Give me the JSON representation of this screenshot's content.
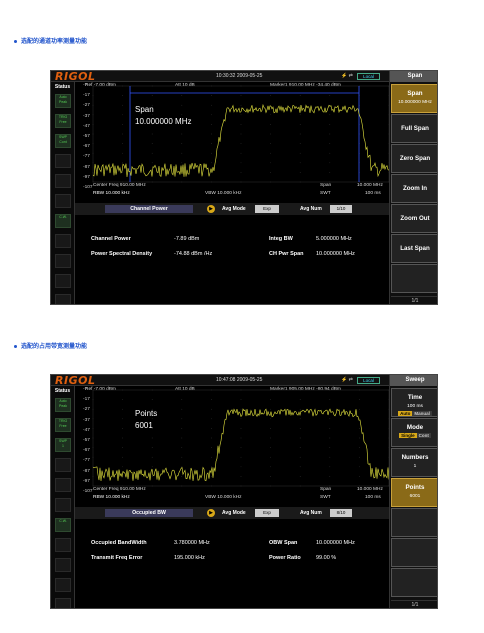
{
  "captions": {
    "cap1": "选配的通道功率测量功能",
    "cap2": "选配的占用带宽测量功能"
  },
  "colors": {
    "trace": "#e8e840",
    "accent": "#d8a818",
    "brand": "#e06010",
    "caption": "#2255cc",
    "lines": "#3355ff"
  },
  "screens": [
    {
      "logo": "RIGOL",
      "datetime": "10:30:32  2009-05-25",
      "local_label": "Local",
      "status_title": "Status",
      "status_icons": [
        {
          "l1": "Auto",
          "l2": "Peak"
        },
        {
          "l1": "TRIG",
          "l2": "Free"
        },
        {
          "l1": "SWP",
          "l2": "Cont"
        },
        {
          "l1": "",
          "l2": ""
        },
        {
          "l1": "",
          "l2": ""
        },
        {
          "l1": "",
          "l2": ""
        },
        {
          "l1": "",
          "l2": "C.W."
        },
        {
          "l1": "",
          "l2": ""
        },
        {
          "l1": "",
          "l2": ""
        },
        {
          "l1": "",
          "l2": ""
        },
        {
          "l1": "",
          "l2": ""
        }
      ],
      "ref": "Ref -7.00 dBm",
      "att": "Att   10 dB",
      "marker": "Marker1  910.00 MHz  -34.40 dBm",
      "y_labels": [
        "-7",
        "-17",
        "-27",
        "-37",
        "-47",
        "-57",
        "-67",
        "-77",
        "-87",
        "-97",
        "-107"
      ],
      "overlay_l1": "Span",
      "overlay_l2": "10.000000 MHz",
      "center": "Center Freq   910.00 MHz",
      "rbw": "RBW          10.000 kHz",
      "vbw": "VBW   10.000 kHz",
      "span": "Span",
      "span_val": "10.000 MHz",
      "swt": "SWT",
      "swt_val": "100 ms",
      "meas_name": "Channel Power",
      "avg_mode_label": "Avg Mode",
      "avg_mode_val": "Exp",
      "avg_num_label": "Avg Num",
      "avg_num_val": "1/10",
      "results": [
        {
          "label": "Channel Power",
          "value": "-7.89 dBm"
        },
        {
          "label": "Power Spectral Density",
          "value": "-74.88 dBm /Hz"
        },
        {
          "label": "Integ BW",
          "value": "5.000000 MHz"
        },
        {
          "label": "CH Pwr Span",
          "value": "10.000000 MHz"
        }
      ],
      "menu_title": "Span",
      "menu": [
        {
          "l1": "Span",
          "l2": "10.000000 MHz"
        },
        {
          "l1": "Full Span"
        },
        {
          "l1": "Zero Span"
        },
        {
          "l1": "Zoom In"
        },
        {
          "l1": "Zoom Out"
        },
        {
          "l1": "Last Span"
        },
        {
          "l1": ""
        }
      ],
      "pager": "1/1"
    },
    {
      "logo": "RIGOL",
      "datetime": "10:47:08  2009-05-25",
      "local_label": "Local",
      "status_title": "Status",
      "status_icons": [
        {
          "l1": "Auto",
          "l2": "Peak"
        },
        {
          "l1": "TRIG",
          "l2": "Free"
        },
        {
          "l1": "SWP",
          "l2": "1"
        },
        {
          "l1": "",
          "l2": ""
        },
        {
          "l1": "",
          "l2": ""
        },
        {
          "l1": "",
          "l2": ""
        },
        {
          "l1": "",
          "l2": "C.W."
        },
        {
          "l1": "",
          "l2": ""
        },
        {
          "l1": "",
          "l2": ""
        },
        {
          "l1": "",
          "l2": ""
        },
        {
          "l1": "",
          "l2": ""
        }
      ],
      "ref": "Ref -7.00 dBm",
      "att": "Att   10 dB",
      "marker": "Marker1  905.00 MHz  -80.94 dBm",
      "y_labels": [
        "-7",
        "-17",
        "-27",
        "-37",
        "-47",
        "-57",
        "-67",
        "-77",
        "-87",
        "-97",
        "-107"
      ],
      "overlay_l1": "Points",
      "overlay_l2": "6001",
      "center": "Center Freq   910.00 MHz",
      "rbw": "RBW          10.000 kHz",
      "vbw": "VBW   10.000 kHz",
      "span": "Span",
      "span_val": "10.000 MHz",
      "swt": "SWT",
      "swt_val": "100 ms",
      "meas_name": "Occupied BW",
      "avg_mode_label": "Avg Mode",
      "avg_mode_val": "Exp",
      "avg_num_label": "Avg Num",
      "avg_num_val": "8/10",
      "results": [
        {
          "label": "Occupied BandWidth",
          "value": "3.780000 MHz"
        },
        {
          "label": "Transmit Freq Error",
          "value": "195.000 kHz"
        },
        {
          "label": "OBW Span",
          "value": "10.000000 MHz"
        },
        {
          "label": "Power Ratio",
          "value": "99.00 %"
        }
      ],
      "menu_title": "Sweep",
      "menu": [
        {
          "l1": "Time",
          "l2": "100 ms",
          "subs": [
            "Auto",
            "Manual"
          ],
          "sub_on": 0
        },
        {
          "l1": "Mode",
          "subs": [
            "Single",
            "Cont"
          ],
          "sub_on": 0
        },
        {
          "l1": "Numbers",
          "l2": "1"
        },
        {
          "l1": "Points",
          "l2": "6001"
        },
        {
          "l1": ""
        },
        {
          "l1": ""
        },
        {
          "l1": ""
        }
      ],
      "pager": "1/1"
    }
  ]
}
